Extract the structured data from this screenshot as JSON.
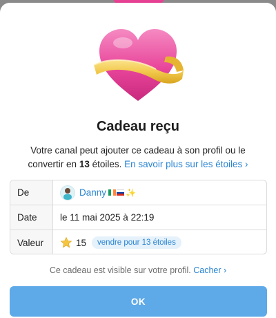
{
  "dialog": {
    "title": "Cadeau reçu",
    "description_before": "Votre canal peut ajouter ce cadeau à son profil ou le convertir en ",
    "description_stars": "13",
    "description_after": " étoiles. ",
    "learn_more_link": "En savoir plus sur les étoiles ›"
  },
  "details": {
    "from_label": "De",
    "sender_name": "Danny",
    "sender_sparkle": "✨",
    "date_label": "Date",
    "date_value": "le 11 mai 2025 à 22:19",
    "value_label": "Valeur",
    "stars_value": "15",
    "sell_label": "vendre pour 13 étoiles"
  },
  "footer": {
    "visibility_text": "Ce cadeau est visible sur votre profil. ",
    "hide_link": "Cacher ›",
    "ok_label": "OK"
  },
  "colors": {
    "accent": "#2a84d2",
    "button": "#5ea9e8",
    "heart": "#e8459a",
    "ribbon": "#f2c94c"
  },
  "icons": {
    "gift": "pink-heart-with-gold-ribbon",
    "close": "close-icon",
    "value": "star-icon",
    "flags": [
      "ireland-flag",
      "russia-flag"
    ]
  }
}
